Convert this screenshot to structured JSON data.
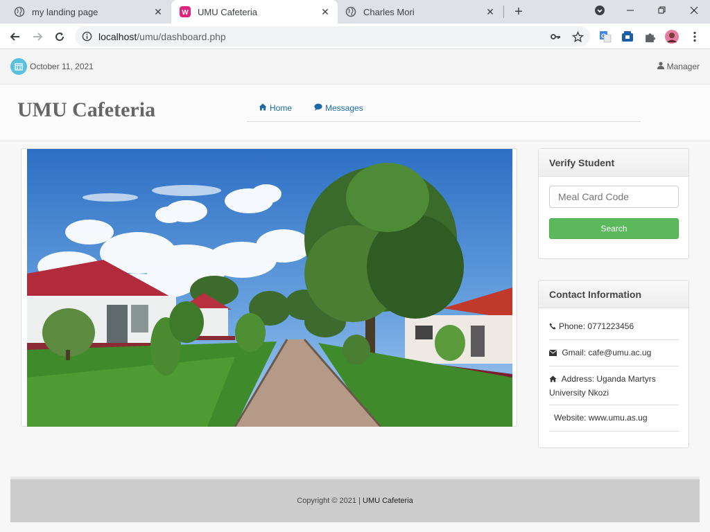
{
  "browser": {
    "tabs": [
      {
        "title": "my landing page",
        "favicon": "globe-icon",
        "active": false
      },
      {
        "title": "UMU Cafeteria",
        "favicon": "wamp-icon",
        "active": true
      },
      {
        "title": "Charles Mori",
        "favicon": "globe-icon",
        "active": false
      }
    ],
    "url_host": "localhost",
    "url_path": "/umu/dashboard.php"
  },
  "topbar": {
    "date": "October 11, 2021",
    "role": "Manager"
  },
  "header": {
    "brand": "UMU Cafeteria",
    "nav": [
      {
        "label": "Home",
        "icon": "home-icon"
      },
      {
        "label": "Messages",
        "icon": "comment-icon"
      }
    ]
  },
  "verify": {
    "title": "Verify Student",
    "placeholder": "Meal Card Code",
    "button": "Search"
  },
  "contact": {
    "title": "Contact Information",
    "phone_label": "Phone:",
    "phone": "0771223456",
    "gmail_label": "Gmail:",
    "gmail": "cafe@umu.ac.ug",
    "address_label": "Address:",
    "address": "Uganda Martyrs University Nkozi",
    "website_label": "Website:",
    "website": "www.umu.as.ug"
  },
  "footer": {
    "copyright": "Copyright © 2021 |",
    "brand": "UMU Cafeteria"
  },
  "colors": {
    "accent": "#1c6aa5",
    "search_button": "#5cb85c",
    "calendar_badge": "#5bc0de"
  }
}
